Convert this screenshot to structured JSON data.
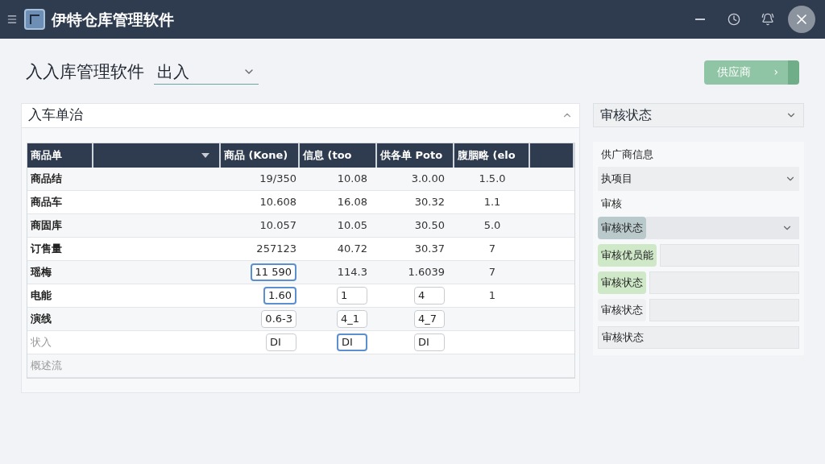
{
  "window": {
    "title": "伊特仓库管理软件"
  },
  "toolbar": {
    "title": "入入库管理软件",
    "mode_select": {
      "value": "出入"
    },
    "supplier_button": {
      "label": "供应商",
      "arrow": "›"
    }
  },
  "panel": {
    "title": "入车单治",
    "expanded": true,
    "table": {
      "columns": [
        {
          "label": "商品单"
        },
        {
          "dropdown": true
        },
        {
          "label": "商品 (Kone)"
        },
        {
          "label": "信息 (too"
        },
        {
          "label": "供各单 Poto"
        },
        {
          "label": "腹胭略 (elo"
        },
        {}
      ],
      "rows": [
        {
          "dim": false,
          "cells": [
            {
              "kind": "label",
              "text": "商品结"
            },
            {
              "kind": "empty"
            },
            {
              "kind": "text",
              "text": "19/350"
            },
            {
              "kind": "text",
              "text": "10.08"
            },
            {
              "kind": "text",
              "text": "3.0.00"
            },
            {
              "kind": "text",
              "text": "1.5.0"
            }
          ]
        },
        {
          "dim": false,
          "cells": [
            {
              "kind": "label",
              "text": "商品车"
            },
            {
              "kind": "empty"
            },
            {
              "kind": "text",
              "text": "10.608"
            },
            {
              "kind": "text",
              "text": "16.08"
            },
            {
              "kind": "text",
              "text": "30.32"
            },
            {
              "kind": "text",
              "text": "1.1"
            }
          ]
        },
        {
          "dim": false,
          "cells": [
            {
              "kind": "label",
              "text": "商固库"
            },
            {
              "kind": "empty"
            },
            {
              "kind": "text",
              "text": "10.057"
            },
            {
              "kind": "text",
              "text": "10.05"
            },
            {
              "kind": "text",
              "text": "30.50"
            },
            {
              "kind": "text",
              "text": "5.0"
            }
          ]
        },
        {
          "dim": false,
          "cells": [
            {
              "kind": "label",
              "text": "订售量"
            },
            {
              "kind": "empty"
            },
            {
              "kind": "text",
              "text": "257123"
            },
            {
              "kind": "text",
              "text": "40.72"
            },
            {
              "kind": "text",
              "text": "30.37"
            },
            {
              "kind": "text",
              "text": "7"
            }
          ]
        },
        {
          "dim": false,
          "cells": [
            {
              "kind": "label",
              "text": "瑶梅"
            },
            {
              "kind": "empty"
            },
            {
              "kind": "input",
              "text": "11 590",
              "focused": true
            },
            {
              "kind": "text",
              "text": "114.3"
            },
            {
              "kind": "text",
              "text": "1.6039"
            },
            {
              "kind": "text",
              "text": "7"
            }
          ]
        },
        {
          "dim": false,
          "cells": [
            {
              "kind": "label",
              "text": "电能"
            },
            {
              "kind": "empty"
            },
            {
              "kind": "input",
              "text": "1.60",
              "focused": true
            },
            {
              "kind": "input",
              "text": "1",
              "focused": false
            },
            {
              "kind": "input",
              "text": "4",
              "focused": false
            },
            {
              "kind": "text",
              "text": "1"
            }
          ]
        },
        {
          "dim": false,
          "cells": [
            {
              "kind": "label",
              "text": "演线"
            },
            {
              "kind": "empty"
            },
            {
              "kind": "input",
              "text": "0.6-3",
              "focused": false
            },
            {
              "kind": "input",
              "text": "4_1",
              "focused": false
            },
            {
              "kind": "input",
              "text": "4_7",
              "focused": false
            }
          ]
        },
        {
          "dim": true,
          "cells": [
            {
              "kind": "label",
              "text": "状入"
            },
            {
              "kind": "empty"
            },
            {
              "kind": "input",
              "text": "DI",
              "focused": false
            },
            {
              "kind": "input",
              "text": "DI",
              "focused": true
            },
            {
              "kind": "input",
              "text": "DI",
              "focused": false
            }
          ]
        },
        {
          "dim": true,
          "cells": [
            {
              "kind": "label",
              "text": "概述流"
            }
          ]
        }
      ]
    }
  },
  "side": {
    "status_select": {
      "value": "审核状态"
    },
    "section_label": "供广商信息",
    "project_select": {
      "value": "执项目"
    },
    "sub_label": "审核",
    "rows": [
      {
        "kind": "select",
        "label": "审核状态",
        "color": "#b9c9cc"
      },
      {
        "kind": "field",
        "label": "审核优员能",
        "color": "#cfe8c8"
      },
      {
        "kind": "textarea",
        "label": "审核状态",
        "color": "#cfe8c8"
      },
      {
        "kind": "field",
        "label": "审核状态",
        "color": "#eef0f2"
      },
      {
        "kind": "value",
        "value": "审核状态"
      }
    ]
  }
}
